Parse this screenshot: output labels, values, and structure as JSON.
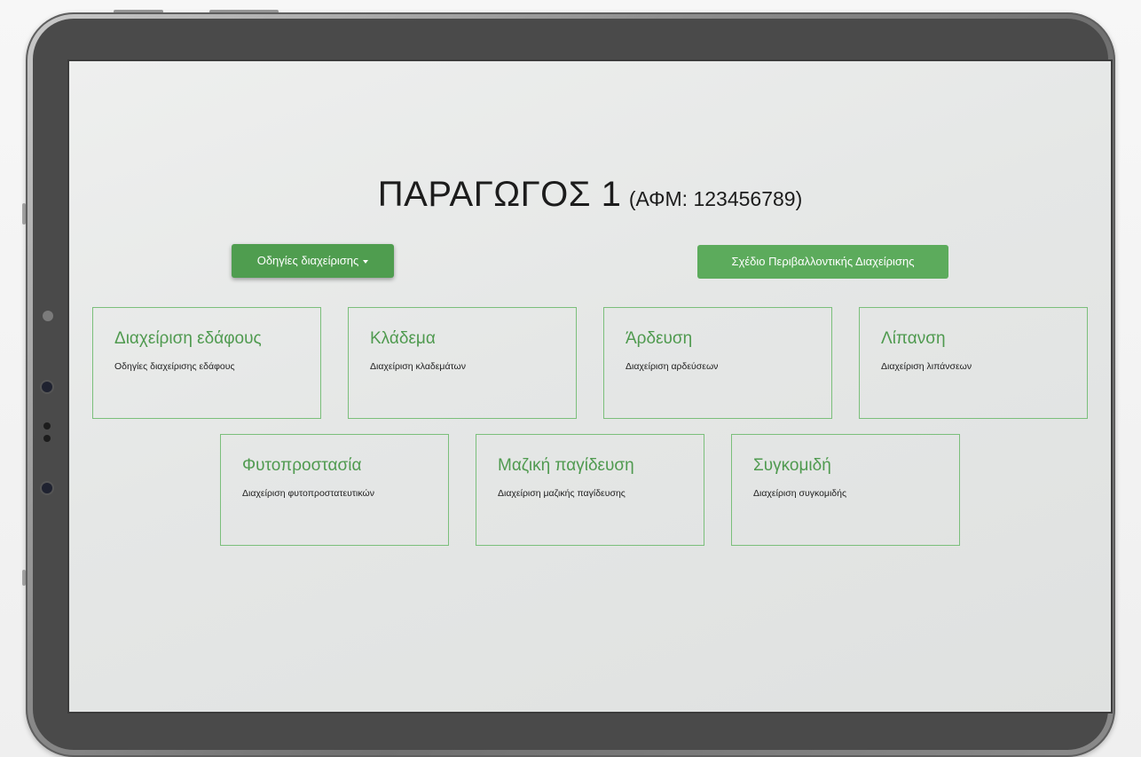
{
  "page": {
    "title": "ΠΑΡΑΓΩΓΟΣ 1",
    "tax_id": "(ΑΦΜ: 123456789)"
  },
  "actions": {
    "instructions_label": "Οδηγίες διαχείρισης",
    "plan_label": "Σχέδιο Περιβαλλοντικής Διαχείρισης"
  },
  "cards": [
    {
      "title": "Διαχείριση εδάφους",
      "description": "Οδηγίες διαχείρισης εδάφους"
    },
    {
      "title": "Κλάδεμα",
      "description": "Διαχείριση κλαδεμάτων"
    },
    {
      "title": "Άρδευση",
      "description": "Διαχείριση αρδεύσεων"
    },
    {
      "title": "Λίπανση",
      "description": "Διαχείριση λιπάνσεων"
    },
    {
      "title": "Φυτοπροστασία",
      "description": "Διαχείριση φυτοπροστατευτικών"
    },
    {
      "title": "Μαζική παγίδευση",
      "description": "Διαχείριση μαζικής παγίδευσης"
    },
    {
      "title": "Συγκομιδή",
      "description": "Διαχείριση συγκομιδής"
    }
  ],
  "colors": {
    "accent_green": "#5cab5c",
    "card_border": "#7bbf7b",
    "card_title": "#4f9a4f",
    "tablet_frame": "#8e8e8e"
  }
}
